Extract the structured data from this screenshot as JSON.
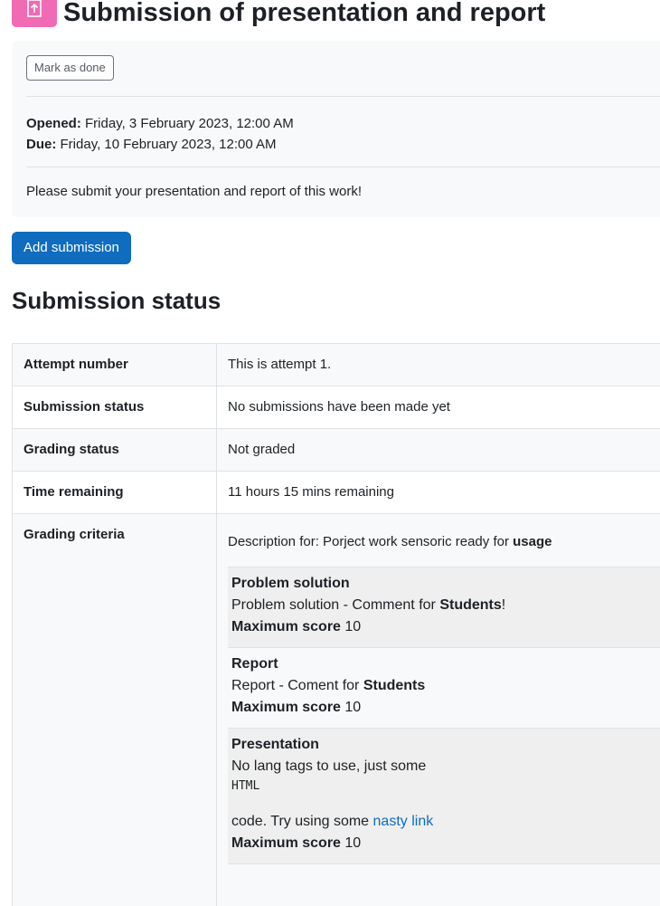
{
  "page": {
    "title": "Submission of presentation and report",
    "icon": "assignment-upload-icon",
    "accent_color": "#f06ab4"
  },
  "activity": {
    "mark_done_label": "Mark as done",
    "opened_label": "Opened:",
    "opened_value": "Friday, 3 February 2023, 12:00 AM",
    "due_label": "Due:",
    "due_value": "Friday, 10 February 2023, 12:00 AM",
    "intro": "Please submit your presentation and report of this work!"
  },
  "actions": {
    "add_submission_label": "Add submission",
    "primary_color": "#0f6cbf"
  },
  "submission_status": {
    "heading": "Submission status",
    "rows": [
      {
        "label": "Attempt number",
        "value": "This is attempt 1."
      },
      {
        "label": "Submission status",
        "value": "No submissions have been made yet"
      },
      {
        "label": "Grading status",
        "value": "Not graded"
      },
      {
        "label": "Time remaining",
        "value": "11 hours 15 mins remaining"
      }
    ],
    "grading_criteria": {
      "label": "Grading criteria",
      "description_prefix": "Description for: Porject work sensoric ready for ",
      "description_bold": "usage",
      "max_score_label": "Maximum score",
      "criteria": [
        {
          "name": "Problem solution",
          "comment_prefix": "Problem solution - Comment for ",
          "comment_bold": "Students",
          "comment_suffix": "!",
          "max_score": "10"
        },
        {
          "name": "Report",
          "comment_prefix": "Report - Coment for ",
          "comment_bold": "Students",
          "comment_suffix": "",
          "max_score": "10"
        },
        {
          "name": "Presentation",
          "comment_line1": "No lang tags to use, just some",
          "code_text": "HTML",
          "comment_line2_prefix": "code. Try using some ",
          "link_text": "nasty link",
          "max_score": "10"
        }
      ]
    }
  }
}
